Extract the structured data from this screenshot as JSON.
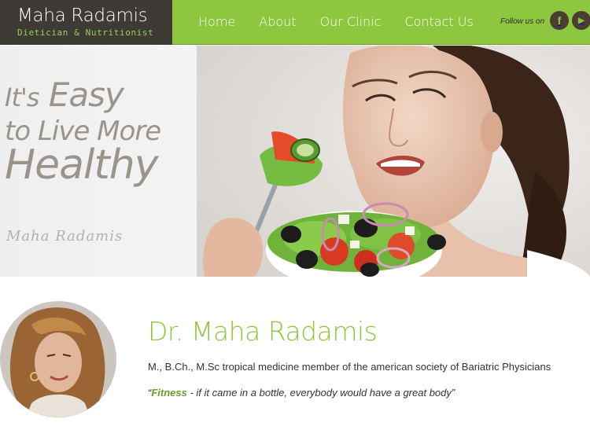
{
  "logo": {
    "name": "Maha Radamis",
    "subtitle": "Dietician & Nutritionist"
  },
  "nav": {
    "items": [
      "Home",
      "About",
      "Our Clinic",
      "Contact Us"
    ]
  },
  "social": {
    "label": "Follow us on",
    "icons": [
      "facebook-icon",
      "youtube-icon"
    ],
    "facebook_glyph": "f",
    "youtube_glyph": "▶"
  },
  "hero": {
    "line1_prefix": "It's",
    "line1_main": "Easy",
    "line2": "to Live More",
    "line3": "Healthy",
    "signature": "Maha Radamis"
  },
  "profile": {
    "name": "Dr. Maha Radamis",
    "credentials": "M., B.Ch., M.Sc tropical medicine member of the american society of Bariatric Physicians",
    "quote_open": "“",
    "quote_bold": "Fitness",
    "quote_rest": " - if it came in a bottle, everybody would have a great body”"
  },
  "colors": {
    "accent": "#8dc63f",
    "logo_bg": "#3e3a36",
    "social_bg": "#4a3e30"
  }
}
